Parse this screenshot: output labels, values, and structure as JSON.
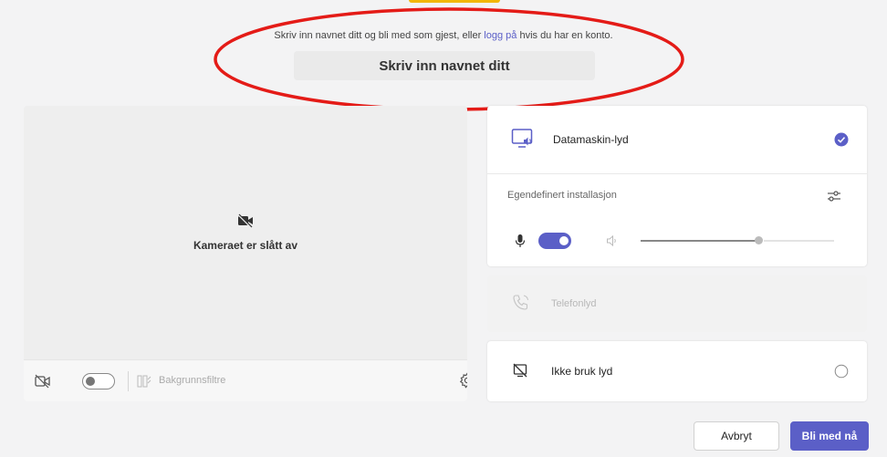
{
  "intro": {
    "text_before": "Skriv inn navnet ditt og bli med som gjest, eller ",
    "login_link": "logg på",
    "text_after": " hvis du har en konto."
  },
  "name_input": {
    "placeholder": "Skriv inn navnet ditt",
    "value": ""
  },
  "video": {
    "camera_off_text": "Kameraet er slått av",
    "camera_toggle_on": false,
    "background_filters_label": "Bakgrunnsfiltre"
  },
  "audio": {
    "computer_audio_label": "Datamaskin-lyd",
    "computer_audio_selected": true,
    "custom_setup_label": "Egendefinert installasjon",
    "mic_on": true,
    "speaker_volume_fraction": 0.6,
    "phone_audio_label": "Telefonlyd",
    "phone_audio_enabled": false,
    "no_audio_label": "Ikke bruk lyd",
    "no_audio_selected": false
  },
  "actions": {
    "cancel_label": "Avbryt",
    "join_label": "Bli med nå"
  },
  "colors": {
    "accent": "#5b5fc7",
    "annotation": "#e41b17"
  }
}
